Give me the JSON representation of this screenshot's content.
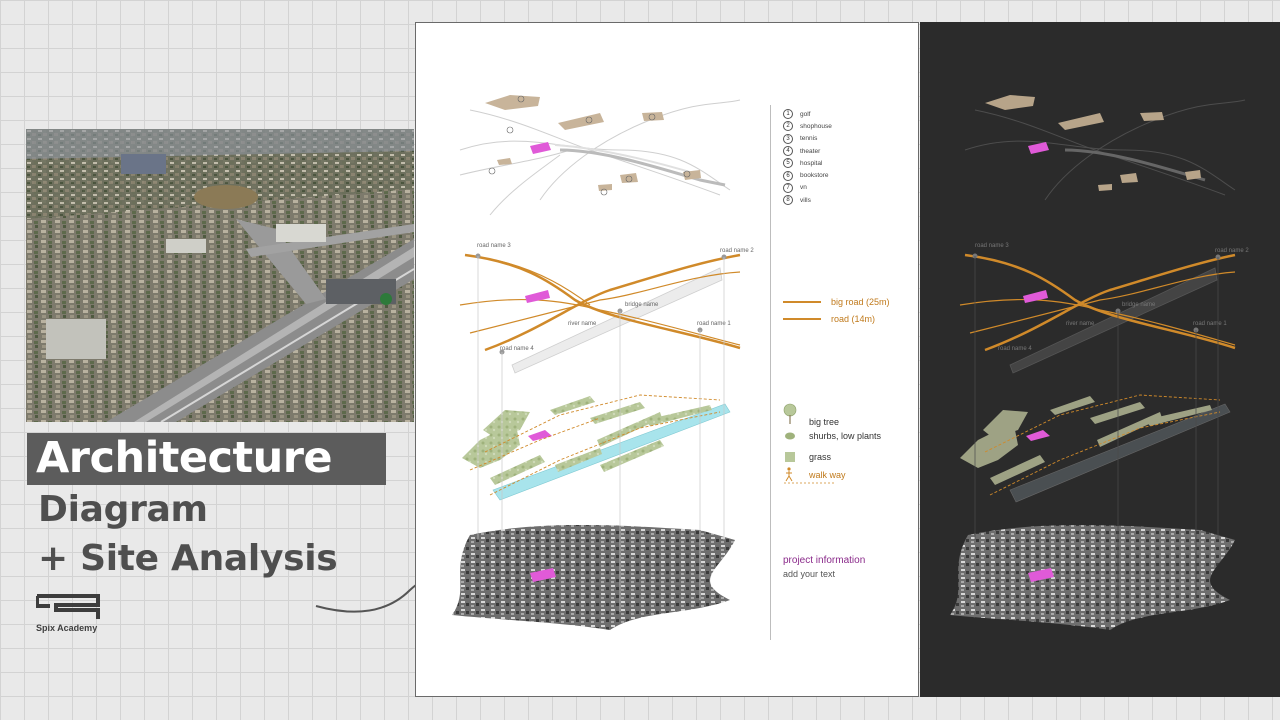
{
  "title": {
    "main": "Architecture",
    "line2": "Diagram",
    "line3": "+ Site Analysis"
  },
  "brand": {
    "name": "Spix Academy"
  },
  "legend_places": [
    {
      "num": "1",
      "label": "golf"
    },
    {
      "num": "2",
      "label": "shophouse"
    },
    {
      "num": "3",
      "label": "tennis"
    },
    {
      "num": "4",
      "label": "theater"
    },
    {
      "num": "5",
      "label": "hospital"
    },
    {
      "num": "6",
      "label": "bookstore"
    },
    {
      "num": "7",
      "label": "vn"
    },
    {
      "num": "8",
      "label": "vills"
    }
  ],
  "legend_roads": {
    "big_road": "big road (25m)",
    "road": "road (14m)"
  },
  "legend_vegetation": {
    "big_tree": "big tree",
    "shrubs": "shurbs, low plants",
    "grass": "grass",
    "walk_way": "walk way"
  },
  "road_labels": {
    "road3": "road name 3",
    "road2": "road name 2",
    "bridge": "bridge name",
    "river": "river name",
    "road1": "road name 1",
    "road4": "road name 4"
  },
  "project_info": {
    "title": "project information",
    "text": "add your text"
  },
  "colors": {
    "road": "#d08a2a",
    "highlight": "#e05ad8",
    "building": "#c8b49a",
    "grass": "#b8c89a",
    "water": "#a8e4ec",
    "dark_bg": "#2b2b2b"
  }
}
